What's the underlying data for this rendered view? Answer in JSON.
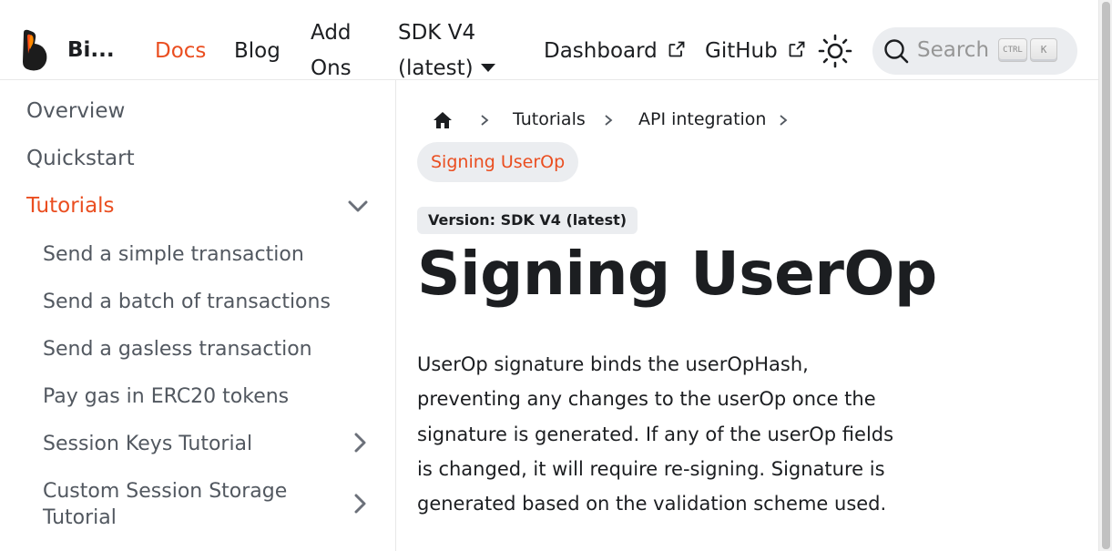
{
  "navbar": {
    "brand": "Bi...",
    "links": {
      "docs": "Docs",
      "blog": "Blog",
      "addons": "Add Ons",
      "version": "SDK V4 (latest)",
      "dashboard": "Dashboard",
      "github": "GitHub"
    },
    "theme_icon": "sun-icon",
    "search": {
      "placeholder": "Search",
      "key_ctrl": "CTRL",
      "key_k": "K"
    },
    "accent_color": "#ea4e20"
  },
  "sidebar": {
    "items": [
      {
        "label": "Overview"
      },
      {
        "label": "Quickstart"
      },
      {
        "label": "Tutorials",
        "active": true,
        "expanded": true
      },
      {
        "label": "Send a simple transaction"
      },
      {
        "label": "Send a batch of transactions"
      },
      {
        "label": "Send a gasless transaction"
      },
      {
        "label": "Pay gas in ERC20 tokens"
      },
      {
        "label": "Session Keys Tutorial"
      },
      {
        "label": "Custom Session Storage Tutorial"
      }
    ]
  },
  "breadcrumb": {
    "home_icon": "home-icon",
    "items": [
      "Tutorials",
      "API integration"
    ],
    "current": "Signing UserOp"
  },
  "main": {
    "version_badge": "Version: SDK V4 (latest)",
    "title": "Signing UserOp",
    "intro": "UserOp signature binds the userOpHash, preventing any changes to the userOp once the signature is generated. If any of the userOp fields is changed, it will require re-signing. Signature is generated based on the validation scheme used."
  }
}
